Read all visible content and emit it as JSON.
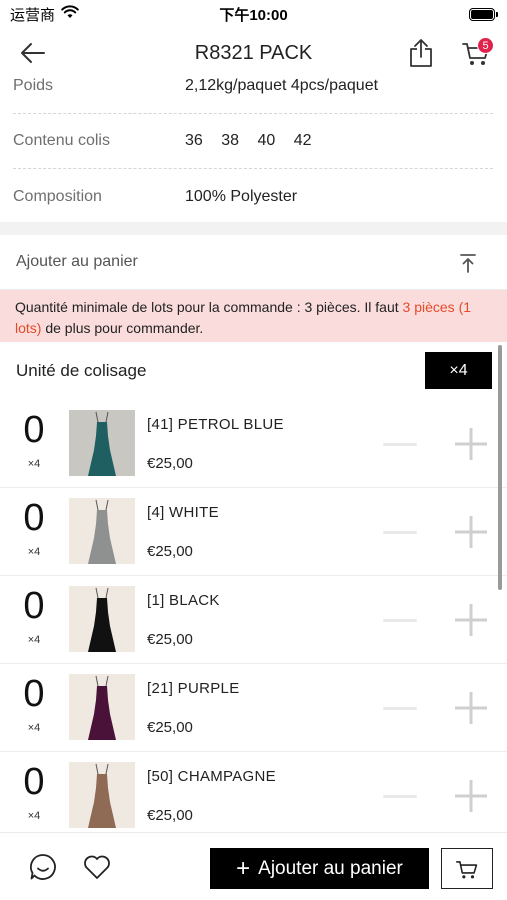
{
  "status_bar": {
    "carrier": "运营商",
    "time": "下午10:00"
  },
  "nav": {
    "title": "R8321 PACK",
    "cart_count": "5"
  },
  "specs": [
    {
      "label": "Poids",
      "value": "2,12kg/paquet 4pcs/paquet"
    },
    {
      "label": "Contenu colis",
      "sizes": [
        "36",
        "38",
        "40",
        "42"
      ]
    },
    {
      "label": "Composition",
      "value": "100% Polyester"
    }
  ],
  "add_to_cart_heading": "Ajouter au panier",
  "notice": {
    "text_before": "Quantité minimale de lots pour la commande : 3 pièces. Il faut ",
    "highlight": "3 pièces (1 lots)",
    "text_after": " de plus pour commander."
  },
  "packing": {
    "label": "Unité de colisage",
    "unit": "×4"
  },
  "products": [
    {
      "qty": "0",
      "unit": "×4",
      "name": "[41] PETROL BLUE",
      "price": "€25,00",
      "color": "#1f5f62",
      "bg": "#c9c7c1"
    },
    {
      "qty": "0",
      "unit": "×4",
      "name": "[4] WHITE",
      "price": "€25,00",
      "color": "#8f9190",
      "bg": "#efe9e2"
    },
    {
      "qty": "0",
      "unit": "×4",
      "name": "[1] BLACK",
      "price": "€25,00",
      "color": "#111111",
      "bg": "#efe9e2"
    },
    {
      "qty": "0",
      "unit": "×4",
      "name": "[21] PURPLE",
      "price": "€25,00",
      "color": "#4a1238",
      "bg": "#efe9e2"
    },
    {
      "qty": "0",
      "unit": "×4",
      "name": "[50] CHAMPAGNE",
      "price": "€25,00",
      "color": "#8f6a55",
      "bg": "#efe9e2"
    }
  ],
  "bottom_bar": {
    "add_to_cart_label": "Ajouter au panier"
  }
}
